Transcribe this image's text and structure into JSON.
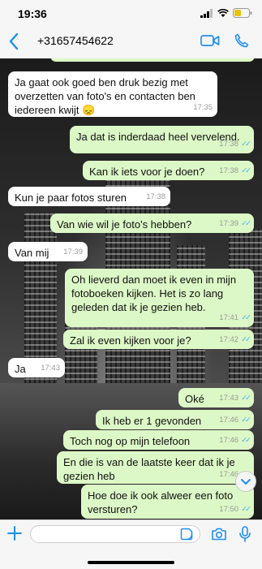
{
  "status": {
    "time": "19:36"
  },
  "header": {
    "contact": "+31657454622"
  },
  "messages": [
    {
      "dir": "in",
      "text": "Ja gaat ook goed ben druk bezig met overzetten van foto's en contacten ben iedereen kwijt 😞",
      "time": "17:35"
    },
    {
      "dir": "out",
      "text": "Ja dat is inderdaad heel vervelend.",
      "time": "17:38"
    },
    {
      "dir": "out",
      "text": "Kan ik iets voor je doen?",
      "time": "17:38"
    },
    {
      "dir": "in",
      "text": "Kun je paar fotos sturen",
      "time": "17:38"
    },
    {
      "dir": "out",
      "text": "Van wie wil je foto's hebben?",
      "time": "17:39"
    },
    {
      "dir": "in",
      "text": "Van mij",
      "time": "17:39"
    },
    {
      "dir": "out",
      "text": "Oh lieverd dan moet ik even in mijn fotoboeken kijken. Het is zo lang geleden dat ik je gezien heb.",
      "time": "17:41"
    },
    {
      "dir": "out",
      "text": "Zal ik even kijken voor je?",
      "time": "17:42"
    },
    {
      "dir": "in",
      "text": "Ja",
      "time": "17:43"
    },
    {
      "dir": "out",
      "text": "Oké",
      "time": "17:43"
    },
    {
      "dir": "out",
      "text": "Ik heb er 1 gevonden",
      "time": "17:46"
    },
    {
      "dir": "out",
      "text": "Toch nog op mijn telefoon",
      "time": "17:46"
    },
    {
      "dir": "out",
      "text": "En die is van de laatste keer dat ik je gezien heb",
      "time": "17:46"
    },
    {
      "dir": "out",
      "text": "Hoe doe ik ook alweer een foto versturen?",
      "time": "17:50"
    }
  ],
  "input": {
    "value": ""
  },
  "colors": {
    "accent": "#1f8ef1",
    "incoming": "#ffffff",
    "outgoing": "#dcf8c6",
    "read_tick": "#4fb6ec"
  },
  "icons": [
    "back-chevron-icon",
    "video-call-icon",
    "phone-icon",
    "signal-icon",
    "wifi-icon",
    "battery-icon",
    "scroll-down-icon",
    "plus-icon",
    "sticker-icon",
    "camera-icon",
    "microphone-icon"
  ]
}
